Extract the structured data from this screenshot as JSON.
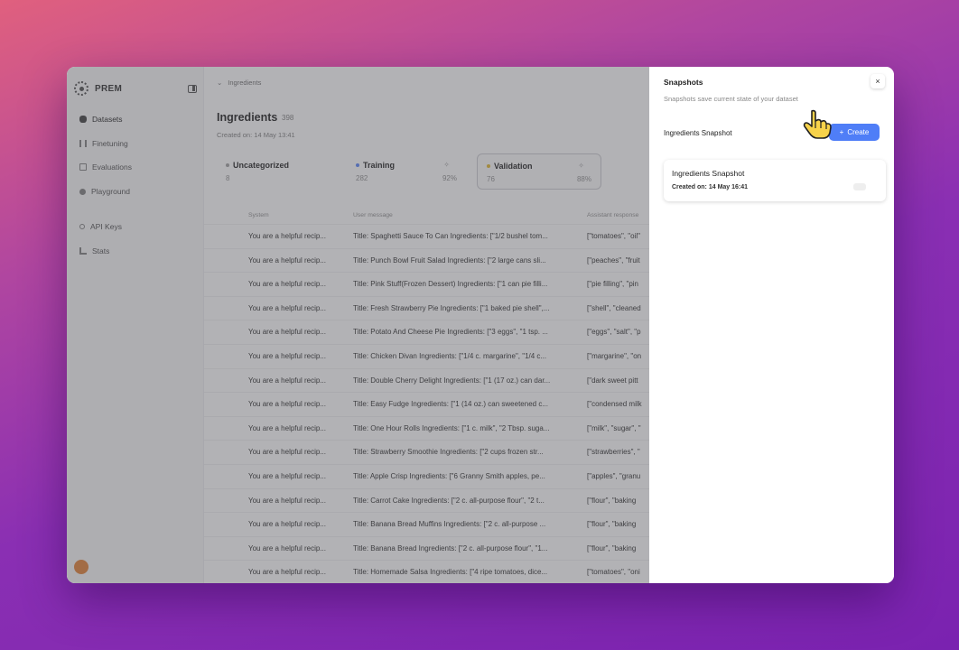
{
  "app": {
    "name": "PREM"
  },
  "sidebar": {
    "items": [
      {
        "label": "Datasets",
        "icon": "database-icon"
      },
      {
        "label": "Finetuning",
        "icon": "finetuning-icon"
      },
      {
        "label": "Evaluations",
        "icon": "evaluations-icon"
      },
      {
        "label": "Playground",
        "icon": "playground-icon"
      },
      {
        "label": "API Keys",
        "icon": "key-icon"
      },
      {
        "label": "Stats",
        "icon": "stats-icon"
      }
    ]
  },
  "main": {
    "breadcrumb": "Ingredients",
    "title": "Ingredients",
    "count": "398",
    "created": "Created on: 14 May 13:41",
    "splits": [
      {
        "name": "Uncategorized",
        "count": "8",
        "dot": "#9a9a9a"
      },
      {
        "name": "Training",
        "count": "282",
        "pct": "92%",
        "dot": "#4f7ef7"
      },
      {
        "name": "Validation",
        "count": "76",
        "pct": "88%",
        "dot": "#e0b320"
      }
    ],
    "columns": [
      "System",
      "User message",
      "Assistant response"
    ],
    "rows": [
      [
        "You are a helpful recip...",
        "Title: Spaghetti Sauce To Can Ingredients: [\"1/2 bushel tom...",
        "[\"tomatoes\", \"oil\""
      ],
      [
        "You are a helpful recip...",
        "Title: Punch Bowl Fruit Salad Ingredients: [\"2 large cans sli...",
        "[\"peaches\", \"fruit"
      ],
      [
        "You are a helpful recip...",
        "Title: Pink Stuff(Frozen Dessert) Ingredients: [\"1 can pie filli...",
        "[\"pie filling\", \"pin"
      ],
      [
        "You are a helpful recip...",
        "Title: Fresh Strawberry Pie Ingredients: [\"1 baked pie shell\",...",
        "[\"shell\", \"cleaned"
      ],
      [
        "You are a helpful recip...",
        "Title: Potato And Cheese Pie Ingredients: [\"3 eggs\", \"1 tsp. ...",
        "[\"eggs\", \"salt\", \"p"
      ],
      [
        "You are a helpful recip...",
        "Title: Chicken Divan Ingredients: [\"1/4 c. margarine\", \"1/4 c...",
        "[\"margarine\", \"on"
      ],
      [
        "You are a helpful recip...",
        "Title: Double Cherry Delight Ingredients: [\"1 (17 oz.) can dar...",
        "[\"dark sweet pitt"
      ],
      [
        "You are a helpful recip...",
        "Title: Easy Fudge Ingredients: [\"1 (14 oz.) can sweetened c...",
        "[\"condensed milk"
      ],
      [
        "You are a helpful recip...",
        "Title: One Hour Rolls Ingredients: [\"1 c. milk\", \"2 Tbsp. suga...",
        "[\"milk\", \"sugar\", \""
      ],
      [
        "You are a helpful recip...",
        "Title: Strawberry Smoothie Ingredients: [\"2 cups frozen str...",
        "[\"strawberries\", \""
      ],
      [
        "You are a helpful recip...",
        "Title: Apple Crisp Ingredients: [\"6 Granny Smith apples, pe...",
        "[\"apples\", \"granu"
      ],
      [
        "You are a helpful recip...",
        "Title: Carrot Cake Ingredients: [\"2 c. all-purpose flour\", \"2 t...",
        "[\"flour\", \"baking"
      ],
      [
        "You are a helpful recip...",
        "Title: Banana Bread Muffins Ingredients: [\"2 c. all-purpose ...",
        "[\"flour\", \"baking"
      ],
      [
        "You are a helpful recip...",
        "Title: Banana Bread Ingredients: [\"2 c. all-purpose flour\", \"1...",
        "[\"flour\", \"baking"
      ],
      [
        "You are a helpful recip...",
        "Title: Homemade Salsa Ingredients: [\"4 ripe tomatoes, dice...",
        "[\"tomatoes\", \"oni"
      ]
    ]
  },
  "snapshots": {
    "title": "Snapshots",
    "subtitle": "Snapshots save current state of your dataset",
    "close": "×",
    "input_value": "Ingredients Snapshot",
    "create_label": "Create",
    "create_icon": "plus-icon",
    "accent": "#4f7ef7",
    "items": [
      {
        "name": "Ingredients Snapshot",
        "created": "Created on: 14 May 16:41"
      }
    ]
  }
}
